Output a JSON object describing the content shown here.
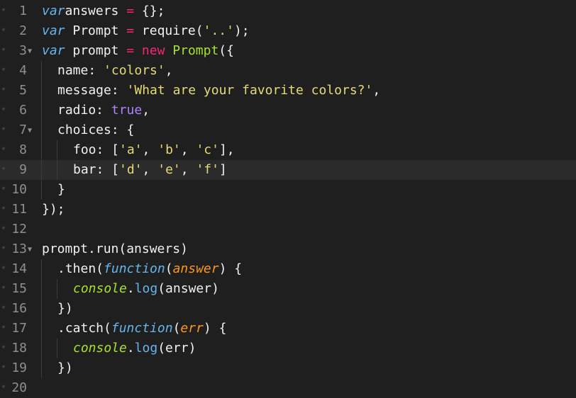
{
  "editor": {
    "lines": [
      {
        "n": "1",
        "fold": false,
        "active": false,
        "indent": 0,
        "tokens": [
          [
            "kw-i",
            "var"
          ],
          [
            "",
            "answers "
          ],
          [
            "op",
            "="
          ],
          [
            "",
            " {};"
          ]
        ]
      },
      {
        "n": "2",
        "fold": false,
        "active": false,
        "indent": 0,
        "tokens": [
          [
            "kw-i",
            "var"
          ],
          [
            "",
            " Prompt "
          ],
          [
            "op",
            "="
          ],
          [
            "",
            " require("
          ],
          [
            "str",
            "'..'"
          ],
          [
            "",
            ");"
          ]
        ]
      },
      {
        "n": "3",
        "fold": true,
        "active": false,
        "indent": 0,
        "tokens": [
          [
            "kw-i",
            "var"
          ],
          [
            "",
            " prompt "
          ],
          [
            "op",
            "="
          ],
          [
            "",
            " "
          ],
          [
            "kw",
            "new"
          ],
          [
            "",
            " "
          ],
          [
            "cls",
            "Prompt"
          ],
          [
            "",
            "({"
          ]
        ]
      },
      {
        "n": "4",
        "fold": false,
        "active": false,
        "indent": 1,
        "tokens": [
          [
            "",
            "name: "
          ],
          [
            "str",
            "'colors'"
          ],
          [
            "",
            ","
          ]
        ]
      },
      {
        "n": "5",
        "fold": false,
        "active": false,
        "indent": 1,
        "tokens": [
          [
            "",
            "message: "
          ],
          [
            "str",
            "'What are your favorite colors?'"
          ],
          [
            "",
            ","
          ]
        ]
      },
      {
        "n": "6",
        "fold": false,
        "active": false,
        "indent": 1,
        "tokens": [
          [
            "",
            "radio: "
          ],
          [
            "bool",
            "true"
          ],
          [
            "",
            ","
          ]
        ]
      },
      {
        "n": "7",
        "fold": true,
        "active": false,
        "indent": 1,
        "tokens": [
          [
            "",
            "choices: {"
          ]
        ]
      },
      {
        "n": "8",
        "fold": false,
        "active": false,
        "indent": 2,
        "tokens": [
          [
            "",
            "foo: ["
          ],
          [
            "str",
            "'a'"
          ],
          [
            "",
            ", "
          ],
          [
            "str",
            "'b'"
          ],
          [
            "",
            ", "
          ],
          [
            "str",
            "'c'"
          ],
          [
            "",
            "],"
          ]
        ]
      },
      {
        "n": "9",
        "fold": false,
        "active": true,
        "indent": 2,
        "tokens": [
          [
            "",
            "bar: ["
          ],
          [
            "str",
            "'d'"
          ],
          [
            "",
            ", "
          ],
          [
            "str",
            "'e'"
          ],
          [
            "",
            ", "
          ],
          [
            "str",
            "'f'"
          ],
          [
            "",
            "]"
          ]
        ]
      },
      {
        "n": "10",
        "fold": false,
        "active": false,
        "indent": 1,
        "tokens": [
          [
            "",
            "}"
          ]
        ]
      },
      {
        "n": "11",
        "fold": false,
        "active": false,
        "indent": 0,
        "tokens": [
          [
            "",
            "});"
          ]
        ]
      },
      {
        "n": "12",
        "fold": false,
        "active": false,
        "indent": 0,
        "tokens": []
      },
      {
        "n": "13",
        "fold": true,
        "active": false,
        "indent": 0,
        "tokens": [
          [
            "",
            "prompt.run(answers)"
          ]
        ]
      },
      {
        "n": "14",
        "fold": false,
        "active": false,
        "indent": 1,
        "tokens": [
          [
            "",
            ".then("
          ],
          [
            "fn",
            "function"
          ],
          [
            "",
            "("
          ],
          [
            "param",
            "answer"
          ],
          [
            "",
            ") {"
          ]
        ]
      },
      {
        "n": "15",
        "fold": false,
        "active": false,
        "indent": 2,
        "tokens": [
          [
            "obj",
            "console"
          ],
          [
            "",
            "."
          ],
          [
            "method",
            "log"
          ],
          [
            "",
            "(answer)"
          ]
        ]
      },
      {
        "n": "16",
        "fold": false,
        "active": false,
        "indent": 1,
        "tokens": [
          [
            "",
            "})"
          ]
        ]
      },
      {
        "n": "17",
        "fold": false,
        "active": false,
        "indent": 1,
        "tokens": [
          [
            "",
            ".catch("
          ],
          [
            "fn",
            "function"
          ],
          [
            "",
            "("
          ],
          [
            "param",
            "err"
          ],
          [
            "",
            ") {"
          ]
        ]
      },
      {
        "n": "18",
        "fold": false,
        "active": false,
        "indent": 2,
        "tokens": [
          [
            "obj",
            "console"
          ],
          [
            "",
            "."
          ],
          [
            "method",
            "log"
          ],
          [
            "",
            "(err)"
          ]
        ]
      },
      {
        "n": "19",
        "fold": false,
        "active": false,
        "indent": 1,
        "tokens": [
          [
            "",
            "})"
          ]
        ]
      },
      {
        "n": "20",
        "fold": false,
        "active": false,
        "indent": 0,
        "tokens": []
      }
    ]
  }
}
